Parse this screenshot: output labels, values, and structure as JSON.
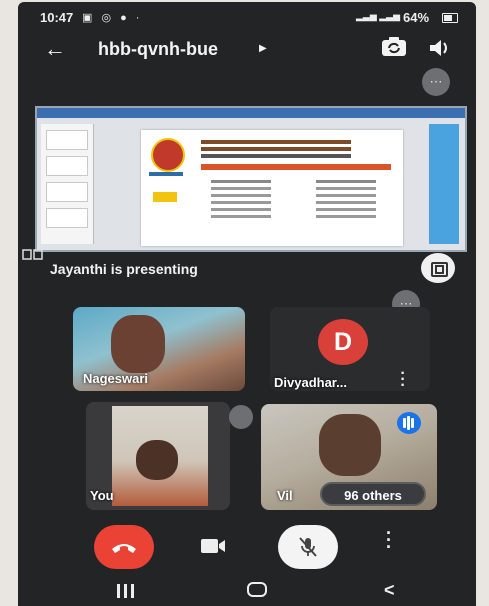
{
  "status_bar": {
    "time": "10:47",
    "battery": "64%",
    "icons": [
      "image-icon",
      "whatsapp-icon",
      "chrome-icon",
      "dot-icon",
      "signal-icon",
      "battery-icon"
    ]
  },
  "top_bar": {
    "title": "hbb-qvnh-bue",
    "icons": [
      "back-arrow-icon",
      "chevron-right-icon",
      "switch-camera-icon",
      "speaker-icon"
    ]
  },
  "presentation": {
    "caption": "Jayanthi is presenting",
    "icons": [
      "screen-share-icon",
      "fullscreen-icon",
      "more-icon"
    ]
  },
  "participants": [
    {
      "name": "Nageswari",
      "type": "video"
    },
    {
      "name": "Divyadhar...",
      "type": "avatar",
      "initial": "D",
      "avatar_color": "#d9403a"
    },
    {
      "name": "You",
      "type": "video"
    },
    {
      "name": "Vil",
      "type": "video",
      "speaking": true
    }
  ],
  "others_count_label": "96 others",
  "controls": {
    "icons": [
      "end-call-icon",
      "camera-icon",
      "mic-off-icon",
      "more-vert-icon"
    ]
  },
  "nav_bar": {
    "icons": [
      "recent-apps-icon",
      "home-icon",
      "back-icon"
    ]
  },
  "colors": {
    "background": "#232426",
    "end_call": "#ea4335",
    "speaking_indicator": "#1a73e8"
  }
}
